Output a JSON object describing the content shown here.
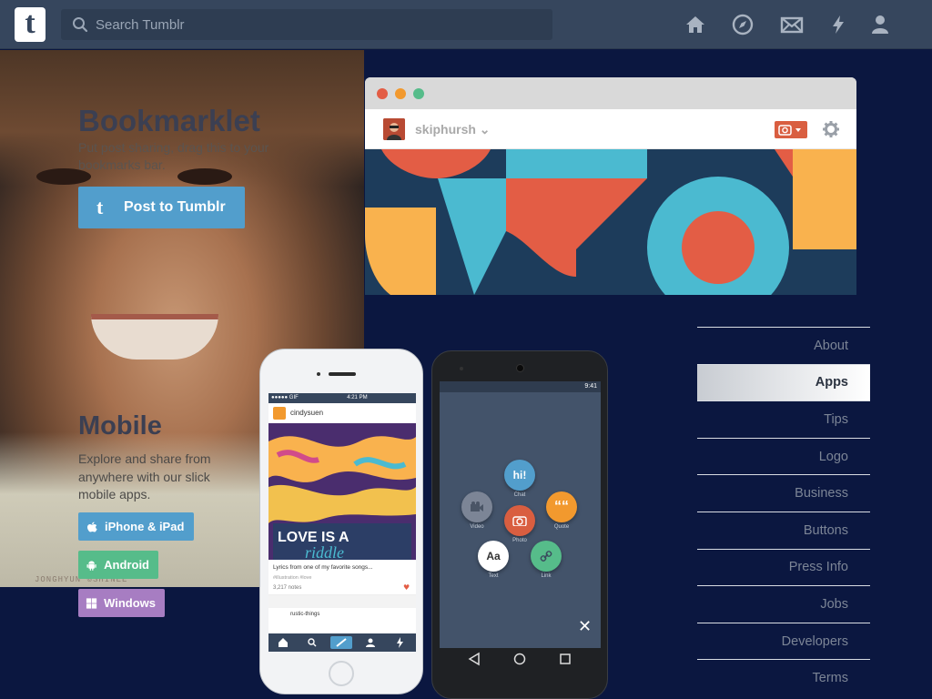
{
  "header": {
    "search_placeholder": "Search Tumblr",
    "icons": [
      "home-icon",
      "explore-icon",
      "inbox-icon",
      "activity-icon",
      "account-icon"
    ]
  },
  "bookmarklet": {
    "title": "Bookmarklet",
    "description": "Put post sharing, drag this to your bookmarks bar.",
    "button_label": "Post to Tumblr"
  },
  "mobile": {
    "title": "Mobile",
    "description": "Explore and share from anywhere with our slick mobile apps.",
    "buttons": {
      "ios": "iPhone & iPad",
      "android": "Android",
      "windows": "Windows"
    }
  },
  "browser_mock": {
    "username": "skiphursh",
    "colors": {
      "navy": "#1d3c5b",
      "red": "#e35d45",
      "cyan": "#4bbad0",
      "yellow": "#f9b24e"
    }
  },
  "iphone_mock": {
    "status_time": "4:21 PM",
    "status_left": "●●●●● GIF",
    "blog_name": "cindysuen",
    "art_text_1": "LOVE IS A",
    "art_text_2": "riddle",
    "caption": "Lyrics from one of my favorite songs...",
    "tags": "#illustration  #love",
    "notes": "3,217 notes",
    "next_blog": "rustic-things"
  },
  "android_mock": {
    "status_time": "9:41",
    "post_types": [
      {
        "label": "Chat",
        "glyph": "hi!",
        "color": "#529ecc"
      },
      {
        "label": "Video",
        "glyph": "■",
        "color": "#7c8596"
      },
      {
        "label": "Quote",
        "glyph": "““",
        "color": "#f2992e"
      },
      {
        "label": "Photo",
        "glyph": "●",
        "color": "#d95e40"
      },
      {
        "label": "Text",
        "glyph": "Aa",
        "color": "#ffffff"
      },
      {
        "label": "Link",
        "glyph": "∞",
        "color": "#56bc8a"
      }
    ]
  },
  "photo_credit": "JONGHYUN ©SHINEE",
  "sidebar": {
    "items": [
      {
        "label": "About",
        "active": false
      },
      {
        "label": "Apps",
        "active": true
      },
      {
        "label": "Tips",
        "active": false
      },
      {
        "label": "Logo",
        "active": false
      },
      {
        "label": "Business",
        "active": false
      },
      {
        "label": "Buttons",
        "active": false
      },
      {
        "label": "Press Info",
        "active": false
      },
      {
        "label": "Jobs",
        "active": false
      },
      {
        "label": "Developers",
        "active": false
      },
      {
        "label": "Terms",
        "active": false
      }
    ]
  }
}
